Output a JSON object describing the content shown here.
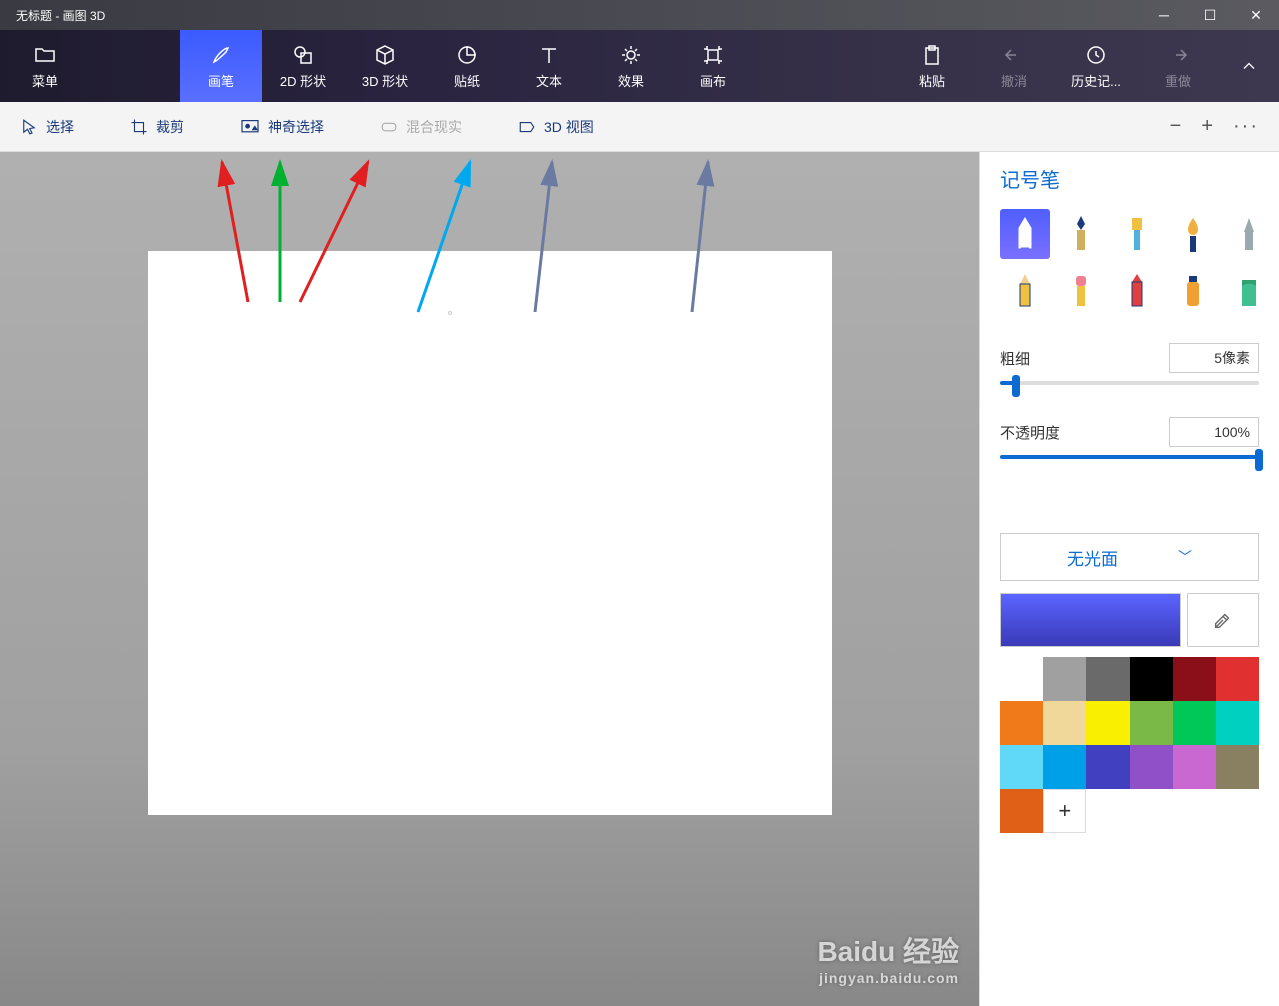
{
  "window": {
    "title": "无标题 - 画图 3D"
  },
  "ribbon": {
    "menu": "菜单",
    "brush": "画笔",
    "shapes2d": "2D 形状",
    "shapes3d": "3D 形状",
    "stickers": "贴纸",
    "text": "文本",
    "effects": "效果",
    "canvas": "画布",
    "paste": "粘贴",
    "undo": "撤消",
    "history": "历史记...",
    "redo": "重做"
  },
  "subbar": {
    "select": "选择",
    "crop": "裁剪",
    "magic": "神奇选择",
    "mixed": "混合现实",
    "view3d": "3D 视图"
  },
  "panel": {
    "title": "记号笔",
    "thickness_label": "粗细",
    "thickness_value": "5像素",
    "opacity_label": "不透明度",
    "opacity_value": "100%",
    "material": "无光面"
  },
  "palette": [
    "#ffffff",
    "#a0a0a0",
    "#6a6a6a",
    "#000000",
    "#8a0f18",
    "#e03030",
    "#f07a1a",
    "#f0d89a",
    "#f8f000",
    "#7ab848",
    "#00c858",
    "#00d0c0",
    "#60d8f8",
    "#00a0e8",
    "#4040c0",
    "#9050c8",
    "#c868d0",
    "#888060"
  ],
  "palette2": [
    "#e06018"
  ],
  "watermark": {
    "brand": "Baidu 经验",
    "url": "jingyan.baidu.com"
  }
}
